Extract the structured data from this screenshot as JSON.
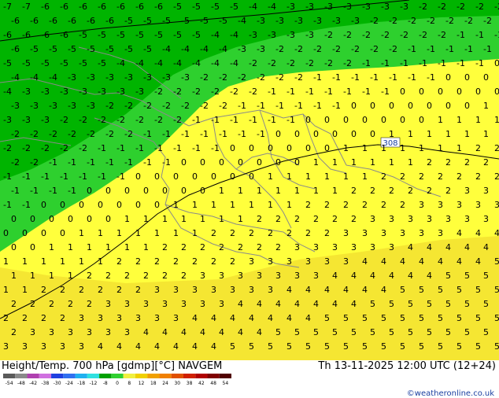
{
  "header": {
    "title_left": "Height/Temp. 700 hPa [gdmp][°C] NAVGEM",
    "title_right": "Th 13-11-2025 12:00 UTC (12+24)",
    "credit": "©weatheronline.co.uk"
  },
  "legend": {
    "labels": [
      "-54",
      "-48",
      "-42",
      "-38",
      "-30",
      "-24",
      "-18",
      "-12",
      "-8",
      "0",
      "8",
      "12",
      "18",
      "24",
      "30",
      "38",
      "42",
      "48",
      "54"
    ],
    "colors": [
      "#5a5a5a",
      "#8a8a8a",
      "#b040b0",
      "#d070e0",
      "#2040e0",
      "#3070f0",
      "#20b0f0",
      "#30e0e0",
      "#00a000",
      "#30d030",
      "#f0f040",
      "#f0d000",
      "#f0a000",
      "#f08000",
      "#e05000",
      "#d02000",
      "#b00000",
      "#800000",
      "#500000"
    ]
  },
  "map": {
    "contour_label": "308",
    "colors": {
      "green_dark": "#00b400",
      "green_light": "#2ed02e",
      "yellow": "#ffff3c",
      "yellow_dark": "#f5e632",
      "border": "#8a8a8a",
      "contour": "#000000"
    }
  }
}
